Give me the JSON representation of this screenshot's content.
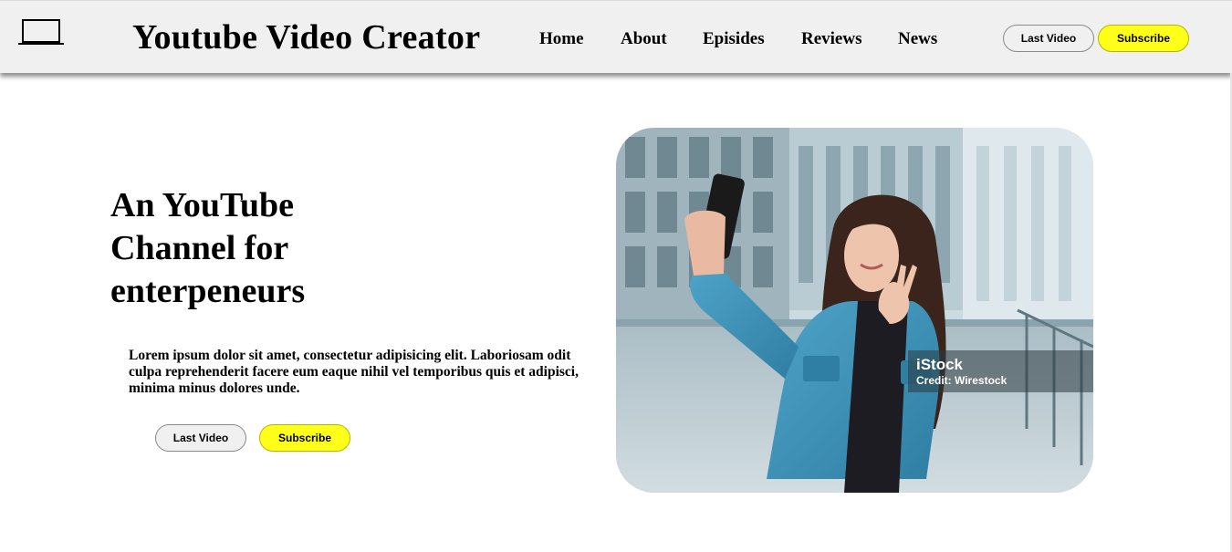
{
  "header": {
    "logo_icon": "laptop-icon",
    "title": "Youtube Video Creator",
    "nav": [
      "Home",
      "About",
      "Episides",
      "Reviews",
      "News"
    ],
    "last_video_label": "Last Video",
    "subscribe_label": "Subscribe"
  },
  "hero": {
    "title": "An YouTube Channel for enterpeneurs",
    "description": "Lorem ipsum dolor sit amet, consectetur adipisicing elit. Laboriosam odit culpa reprehenderit facere eum eaque nihil vel temporibus quis et adipisci, minima minus dolores unde.",
    "last_video_label": "Last Video",
    "subscribe_label": "Subscribe",
    "image": {
      "watermark_brand": "iStock",
      "watermark_credit": "Credit: Wirestock"
    }
  },
  "colors": {
    "header_bg": "#f0f0f0",
    "subscribe_yellow": "#ffff1a",
    "outline_button_bg": "#f0f0f0"
  }
}
